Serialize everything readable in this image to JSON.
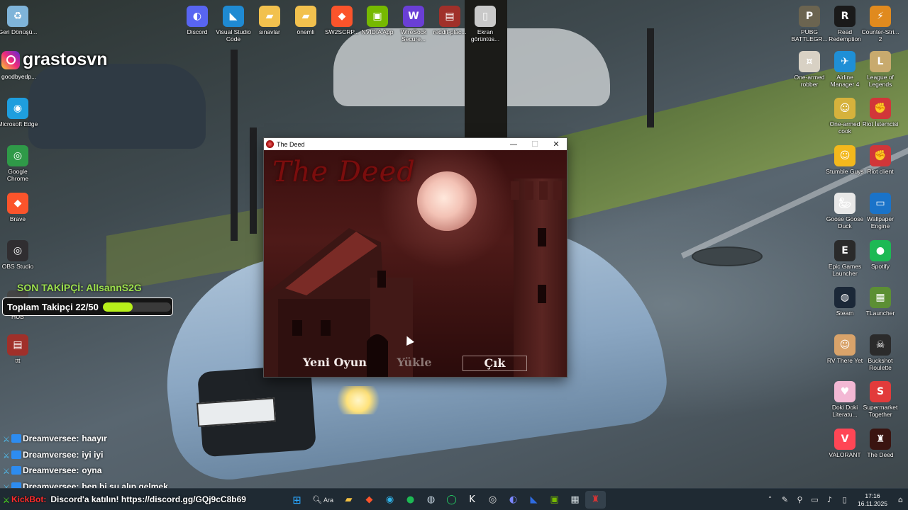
{
  "desktop_icons": [
    {
      "label": "Geri Dönüşü...",
      "icon": "recycle-bin-icon",
      "color": "#7fb4d9"
    },
    {
      "label": "Discord",
      "icon": "discord-icon",
      "color": "#5865f2"
    },
    {
      "label": "Visual Studio Code",
      "icon": "vscode-icon",
      "color": "#1f8ad2"
    },
    {
      "label": "sınavlar",
      "icon": "folder-icon",
      "color": "#f2c14e"
    },
    {
      "label": "önemli",
      "icon": "folder-icon",
      "color": "#f2c14e"
    },
    {
      "label": "SW2SCRP...",
      "icon": "brave-icon",
      "color": "#fb542b"
    },
    {
      "label": "NVIDIA App",
      "icon": "nvidia-icon",
      "color": "#76b900"
    },
    {
      "label": "WireSock Secure...",
      "icon": "wiresock-icon",
      "color": "#6a3fd6"
    },
    {
      "label": "reddit-plac...",
      "icon": "winrar-icon",
      "color": "#a0302a"
    },
    {
      "label": "Ekran görüntüs...",
      "icon": "file-icon",
      "color": "#c9c9c9"
    },
    {
      "label": "PUBG BATTLEGR...",
      "icon": "pubg-icon",
      "color": "#6b6450"
    },
    {
      "label": "Read Redemption",
      "icon": "rdr-icon",
      "color": "#1a1a1a"
    },
    {
      "label": "Counter-Stri... 2",
      "icon": "cs2-icon",
      "color": "#e08a1e"
    },
    {
      "label": "Microsoft Edge",
      "icon": "edge-icon",
      "color": "#1e9ede"
    },
    {
      "label": "Google Chrome",
      "icon": "chrome-icon",
      "color": "#2f9a48"
    },
    {
      "label": "Brave",
      "icon": "brave-icon",
      "color": "#fb542b"
    },
    {
      "label": "OBS Studio",
      "icon": "obs-icon",
      "color": "#302e31"
    },
    {
      "label": "HUB",
      "icon": "hub-icon",
      "color": "#444"
    },
    {
      "label": "ttt",
      "icon": "winrar-icon",
      "color": "#a0302a"
    },
    {
      "label": "One-armed robber",
      "icon": "one-armed-robber-icon",
      "color": "#d8d1c4"
    },
    {
      "label": "Airline Manager 4",
      "icon": "airline-icon",
      "color": "#1f8fd6"
    },
    {
      "label": "League of Legends",
      "icon": "lol-icon",
      "color": "#c8aa6e"
    },
    {
      "label": "One-armed cook",
      "icon": "one-armed-cook-icon",
      "color": "#d6b23c"
    },
    {
      "label": "Riot İstemcisi",
      "icon": "riot-icon",
      "color": "#d13639"
    },
    {
      "label": "Stumble Guys",
      "icon": "stumble-icon",
      "color": "#f3b81c"
    },
    {
      "label": "Riot client",
      "icon": "riot-icon",
      "color": "#d13639"
    },
    {
      "label": "Goose Goose Duck",
      "icon": "goose-icon",
      "color": "#e8e8e8"
    },
    {
      "label": "Wallpaper Engine",
      "icon": "wallpaper-engine-icon",
      "color": "#1a73c9"
    },
    {
      "label": "Epic Games Launcher",
      "icon": "epic-icon",
      "color": "#2a2a2a"
    },
    {
      "label": "Spotify",
      "icon": "spotify-icon",
      "color": "#1db954"
    },
    {
      "label": "Steam",
      "icon": "steam-icon",
      "color": "#1b2838"
    },
    {
      "label": "TLauncher",
      "icon": "tlauncher-icon",
      "color": "#5c8f34"
    },
    {
      "label": "RV There Yet",
      "icon": "rv-icon",
      "color": "#d9a36a"
    },
    {
      "label": "Buckshot Roulette",
      "icon": "buckshot-icon",
      "color": "#2b2b2b"
    },
    {
      "label": "Doki Doki Literatu...",
      "icon": "ddlc-icon",
      "color": "#f3b8d4"
    },
    {
      "label": "Supermarket Together",
      "icon": "supermarket-icon",
      "color": "#e23b3b"
    },
    {
      "label": "VALORANT",
      "icon": "valorant-icon",
      "color": "#ff4655"
    },
    {
      "label": "The Deed",
      "icon": "the-deed-icon",
      "color": "#3a1410"
    }
  ],
  "overlay": {
    "instagram_handle": "grastosvn",
    "instagram_sub": "goodbyedp...",
    "last_follower": "SON TAKİPÇİ: AlIsannS2G",
    "follower_goal": "Toplam Takipçi 22/50",
    "follower_progress": 0.44
  },
  "chat": [
    {
      "user": "Dreamversee:",
      "message": "haayır"
    },
    {
      "user": "Dreamversee:",
      "message": "iyi iyi"
    },
    {
      "user": "Dreamversee:",
      "message": "oyna"
    },
    {
      "user": "Dreamversee:",
      "message": "ben bi su alıp gelmek"
    }
  ],
  "kickbot": {
    "user": "KickBot:",
    "message": "Discord'a katılın! https://discord.gg/GQj9cC8b69"
  },
  "window": {
    "title": "The Deed",
    "minimize": "—",
    "maximize": "☐",
    "close": "✕"
  },
  "game": {
    "logo": "The Deed",
    "menu": [
      {
        "label": "Yeni Oyun",
        "state": "normal"
      },
      {
        "label": "Yükle",
        "state": "disabled"
      },
      {
        "label": "Çık",
        "state": "selected"
      }
    ]
  },
  "taskbar": {
    "search_label": "Ara",
    "pinned": [
      "start-icon",
      "search-icon",
      "file-explorer-icon",
      "brave-icon",
      "edge-icon",
      "spotify-icon",
      "steam-icon",
      "whatsapp-icon",
      "kick-icon",
      "obs-icon",
      "discord-icon",
      "vscode-icon",
      "nvidia-icon",
      "calculator-icon",
      "the-deed-icon"
    ],
    "time": "17:16",
    "date": "16.11.2025"
  }
}
